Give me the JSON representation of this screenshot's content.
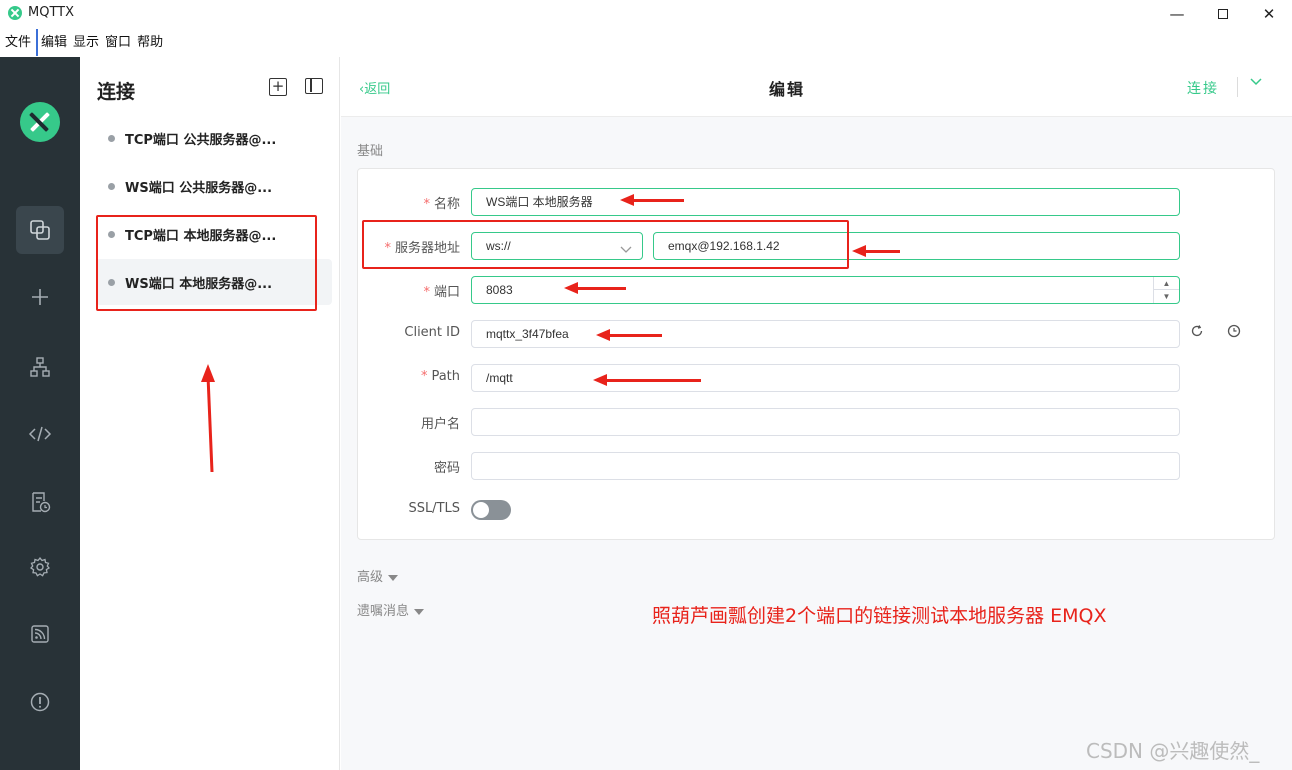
{
  "window": {
    "title": "MQTTX",
    "minimize": "—",
    "close": "✕"
  },
  "menu": [
    "文件",
    "编辑",
    "显示",
    "窗口",
    "帮助"
  ],
  "connections": {
    "title": "连接",
    "add": "+",
    "items": [
      {
        "name": "TCP端口 公共服务器@...",
        "selected": false
      },
      {
        "name": "WS端口 公共服务器@...",
        "selected": false
      },
      {
        "name": "TCP端口 本地服务器@...",
        "selected": false
      },
      {
        "name": "WS端口 本地服务器@...",
        "selected": true
      }
    ]
  },
  "header": {
    "back": "返回",
    "title": "编辑",
    "connect": "连接"
  },
  "form": {
    "section": "基础",
    "name": {
      "label": "名称",
      "value": "WS端口 本地服务器"
    },
    "host": {
      "label": "服务器地址",
      "protocol": "ws://",
      "value": "emqx@192.168.1.42"
    },
    "port": {
      "label": "端口",
      "value": "8083"
    },
    "client_id": {
      "label": "Client ID",
      "value": "mqttx_3f47bfea"
    },
    "path": {
      "label": "Path",
      "value": "/mqtt"
    },
    "username": {
      "label": "用户名",
      "value": ""
    },
    "password": {
      "label": "密码",
      "value": ""
    },
    "ssl": {
      "label": "SSL/TLS",
      "enabled": false
    }
  },
  "advanced": "高级",
  "will": "遗嘱消息",
  "annotation": "照葫芦画瓢创建2个端口的链接测试本地服务器 EMQX",
  "watermark": "CSDN @兴趣使然_",
  "colors": {
    "accent": "#36c98a",
    "sidebar": "#283237",
    "annotation": "#e8231b"
  },
  "icons": [
    "connections-icon",
    "plus-icon",
    "topology-icon",
    "script-icon",
    "log-icon",
    "settings-icon",
    "subscribe-icon",
    "about-icon"
  ]
}
